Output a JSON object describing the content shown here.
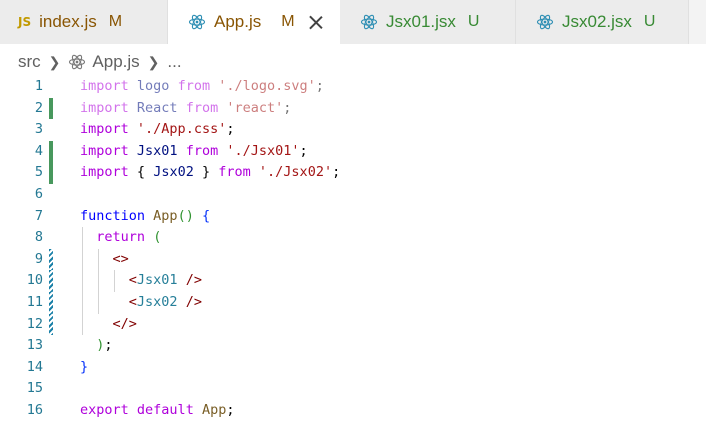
{
  "tabs": [
    {
      "icon": "js-file-icon",
      "badge": "JS",
      "label": "index.js",
      "status": "M",
      "active": false
    },
    {
      "icon": "react-icon",
      "label": "App.js",
      "status": "M",
      "active": true
    },
    {
      "icon": "react-icon",
      "label": "Jsx01.jsx",
      "status": "U",
      "active": false
    },
    {
      "icon": "react-icon",
      "label": "Jsx02.jsx",
      "status": "U",
      "active": false
    }
  ],
  "breadcrumb": {
    "folder": "src",
    "file": "App.js",
    "more": "..."
  },
  "colors": {
    "modified": "#895503",
    "untracked": "#388a34",
    "react_icon": "#2f8fb4",
    "gutter_added": "#48985d",
    "gutter_modified": "#1b81a8",
    "line_number": "#237893"
  },
  "editor": {
    "line_numbers": [
      "1",
      "2",
      "3",
      "4",
      "5",
      "6",
      "7",
      "8",
      "9",
      "10",
      "11",
      "12",
      "13",
      "14",
      "15",
      "16"
    ],
    "l1": {
      "kw": "import",
      "name": "logo",
      "from": "from",
      "str": "'./logo.svg'",
      "semi": ";"
    },
    "l2": {
      "kw": "import",
      "name": "React",
      "from": "from",
      "str": "'react'",
      "semi": ";"
    },
    "l3": {
      "kw": "import",
      "str": "'./App.css'",
      "semi": ";"
    },
    "l4": {
      "kw": "import",
      "name": "Jsx01",
      "from": "from",
      "str": "'./Jsx01'",
      "semi": ";"
    },
    "l5": {
      "kw": "import",
      "open": "{",
      "name": "Jsx02",
      "close": "}",
      "from": "from",
      "str": "'./Jsx02'",
      "semi": ";"
    },
    "l7": {
      "kw": "function",
      "fn": "App",
      "parens": "()",
      "brace": "{"
    },
    "l8": {
      "kw": "return",
      "paren": "("
    },
    "l9": {
      "tag": "<>"
    },
    "l10": {
      "lt": "<",
      "name": "Jsx01",
      "end": " />"
    },
    "l11": {
      "lt": "<",
      "name": "Jsx02",
      "end": " />"
    },
    "l12": {
      "tag": "</>"
    },
    "l13": {
      "paren": ")",
      "semi": ";"
    },
    "l14": {
      "brace": "}"
    },
    "l16": {
      "kw1": "export",
      "kw2": "default",
      "name": "App",
      "semi": ";"
    }
  }
}
